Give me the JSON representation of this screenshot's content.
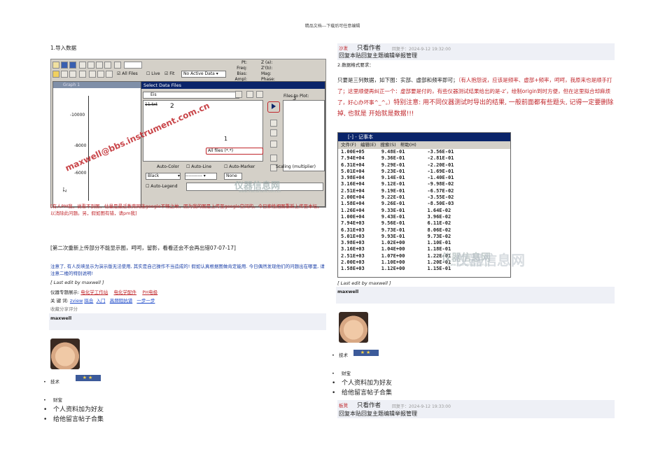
{
  "header": {
    "note": "精品文档---下载后可任意编辑"
  },
  "left": {
    "section_title": "1.导入数据",
    "shot": {
      "toolbar_checks": [
        "All Files",
        "Live",
        "Fit"
      ],
      "dropdown_active": "No Active Data",
      "top_labels": [
        "Pt:",
        "Freq:",
        "Bias:",
        "Ampl:"
      ],
      "top_labels2": [
        "Z (a):",
        "Z'(b):",
        "Mag:",
        "Phase:"
      ],
      "graph_title": "Graph 1",
      "y_ticks": [
        "-10000",
        "-8000",
        "-6000"
      ],
      "y_axis": "Z''",
      "dialog_title": "Select Data Files",
      "folder": "Eis",
      "file": "11.txt",
      "files_to_plot": "Files to Plot:",
      "filter": "All files (*.*)",
      "num1": "1",
      "num2": "2",
      "num3": "3",
      "opt_labels": [
        "Auto-Color",
        "Auto-Line",
        "Auto-Marker",
        "Scaling (multiplier)"
      ],
      "color_value": "Black",
      "none_value": "None",
      "auto_legend": "Auto-Legend",
      "watermark": "maxwell@bbs.instrument.com.cn",
      "logo": "仪器信息网",
      "logo_url": "www.instrument.com.cn"
    },
    "p1": "[有人PM我，说看不到图，估量是最近教育网连google不畅之故，因为我的图是上传至google空间的。今日索性把图重新上传至本坛，以消除此问题。另，假如图有错，请pm我]",
    "p2": "[第二次重新上传部分不能显示图，呵呵，留影，看看还会不会再出错07-07-17]",
    "p3": "注意了, 有人反映显示为演示版无法使用, 其实是自己操作不当造成的! 假如认真根据图做肯定能用. 今日偶然发现他们的问题出在哪里, 请注意二楼的特别说明!",
    "last_edit": "[ Last edit by maxwell ]",
    "tags_label": "仪器专题展示:",
    "tags": [
      "电化学工作站",
      "电化学配件",
      "PH电极"
    ],
    "kw_label": "关 键 词:",
    "keywords": [
      "zview",
      "拟合",
      "入门",
      "高频阻抗谱",
      "一步一步"
    ],
    "share": "收藏分享评分",
    "author": "maxwell",
    "badge_label": "技术",
    "profile": {
      "label": "财宝",
      "items": [
        "个人资料加为好友",
        "给他留言帖子合集"
      ]
    }
  },
  "right": {
    "post1": {
      "floor": "沙发",
      "who": "只看作者",
      "time": "回复于：2024-9-12 19:32:00",
      "actions": "回复本贴回复主题编辑举报管理"
    },
    "section_title": "2.数据格式要求：",
    "para_a": "只要是三列数据，如下图：实部、虚部和频率即可；",
    "para_b": "（有人抱怨说，应该是频率、虚部+频率，呵呵，我原来也是顺手打了；这里顺便再纠正一个：虚部要是付的，有些仪器测试结果给出的是-z'，绘制origin到时方便，但在这里拟合却麻烦了，好心办坏事^_^。）",
    "para_c": "特别注意: 用不同仪器测试时导出的结果, 一般前面都有些题头, 记得一定要删除掉, 也就是 开始就是数据!!!",
    "notepad": {
      "title": "[-] - 记事本",
      "menu": [
        "文件(F)",
        "编辑(E)",
        "搜索(S)",
        "帮助(H)"
      ],
      "rows": [
        [
          "1.00E+05",
          "9.48E-01",
          "-3.56E-01"
        ],
        [
          "7.94E+04",
          "9.36E-01",
          "-2.81E-01"
        ],
        [
          "6.31E+04",
          "9.29E-01",
          "-2.20E-01"
        ],
        [
          "5.01E+04",
          "9.23E-01",
          "-1.69E-01"
        ],
        [
          "3.98E+04",
          "9.14E-01",
          "-1.40E-01"
        ],
        [
          "3.16E+04",
          "9.12E-01",
          "-9.98E-02"
        ],
        [
          "2.51E+04",
          "9.19E-01",
          "-6.57E-02"
        ],
        [
          "2.00E+04",
          "9.22E-01",
          "-3.55E-02"
        ],
        [
          "1.58E+04",
          "9.26E-01",
          "-8.50E-03"
        ],
        [
          "1.26E+04",
          "9.33E-01",
          "1.64E-02"
        ],
        [
          "1.00E+04",
          "9.43E-01",
          "3.96E-02"
        ],
        [
          "7.94E+03",
          "9.56E-01",
          "6.11E-02"
        ],
        [
          "6.31E+03",
          "9.73E-01",
          "8.06E-02"
        ],
        [
          "5.01E+03",
          "9.93E-01",
          "9.73E-02"
        ],
        [
          "3.98E+03",
          "1.02E+00",
          "1.10E-01"
        ],
        [
          "3.16E+03",
          "1.04E+00",
          "1.18E-01"
        ],
        [
          "2.51E+03",
          "1.07E+00",
          "1.22E-01"
        ],
        [
          "2.00E+03",
          "1.10E+00",
          "1.20E-01"
        ],
        [
          "1.58E+03",
          "1.12E+00",
          "1.15E-01"
        ]
      ]
    },
    "last_edit": "[ Last edit by maxwell ]",
    "author": "maxwell",
    "badge_label": "技术",
    "profile": {
      "label": "财宝",
      "items": [
        "个人资料加为好友",
        "给他留言帖子合集"
      ]
    },
    "post2": {
      "floor": "板凳",
      "who": "只看作者",
      "time": "回复于：2024-9-12 19:33:00",
      "actions": "回复本贴回复主题编辑举报管理"
    },
    "logo": "仪器信息网",
    "logo_url": "www.instrument.com.cn"
  }
}
